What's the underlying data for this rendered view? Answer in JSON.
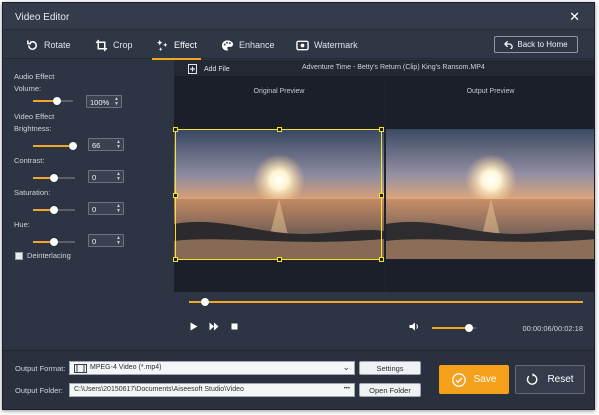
{
  "window": {
    "title": "Video Editor",
    "close_glyph": "✕"
  },
  "tabs": [
    {
      "label": "Rotate",
      "icon": "rotate-icon"
    },
    {
      "label": "Crop",
      "icon": "crop-icon"
    },
    {
      "label": "Effect",
      "icon": "effect-icon",
      "active": true
    },
    {
      "label": "Enhance",
      "icon": "enhance-icon"
    },
    {
      "label": "Watermark",
      "icon": "watermark-icon"
    }
  ],
  "back_home_label": "Back to Home",
  "audio": {
    "section_label": "Audio Effect",
    "volume_label": "Volume:",
    "volume_value": "100%",
    "volume_level": 0.6
  },
  "video": {
    "section_label": "Video Effect",
    "brightness_label": "Brightness:",
    "brightness_value": "66",
    "brightness_level": 0.95,
    "contrast_label": "Contrast:",
    "contrast_value": "0",
    "contrast_level": 0.5,
    "saturation_label": "Saturation:",
    "saturation_value": "0",
    "saturation_level": 0.5,
    "hue_label": "Hue:",
    "hue_value": "0",
    "hue_level": 0.5,
    "deinterlacing_label": "Deinterlacing"
  },
  "file": {
    "add_file_label": "Add File",
    "name": "Adventure Time - Betty's Return (Clip) King's Ransom.MP4"
  },
  "preview": {
    "original_label": "Original Preview",
    "output_label": "Output Preview"
  },
  "playback": {
    "progress": 0.04,
    "volume_level": 0.85,
    "time": "00:00:06/00:02:18"
  },
  "output": {
    "format_label": "Output Format:",
    "format_value": "MPEG-4 Video (*.mp4)",
    "settings_label": "Settings",
    "folder_label": "Output Folder:",
    "folder_value": "C:\\Users\\20150617\\Documents\\Aiseesoft Studio\\Video",
    "folder_dots": "•••",
    "open_folder_label": "Open Folder",
    "save_label": "Save",
    "reset_label": "Reset"
  },
  "colors": {
    "accent": "#f5a623",
    "crop_frame": "#f5e12e",
    "background": "#2d3443"
  }
}
